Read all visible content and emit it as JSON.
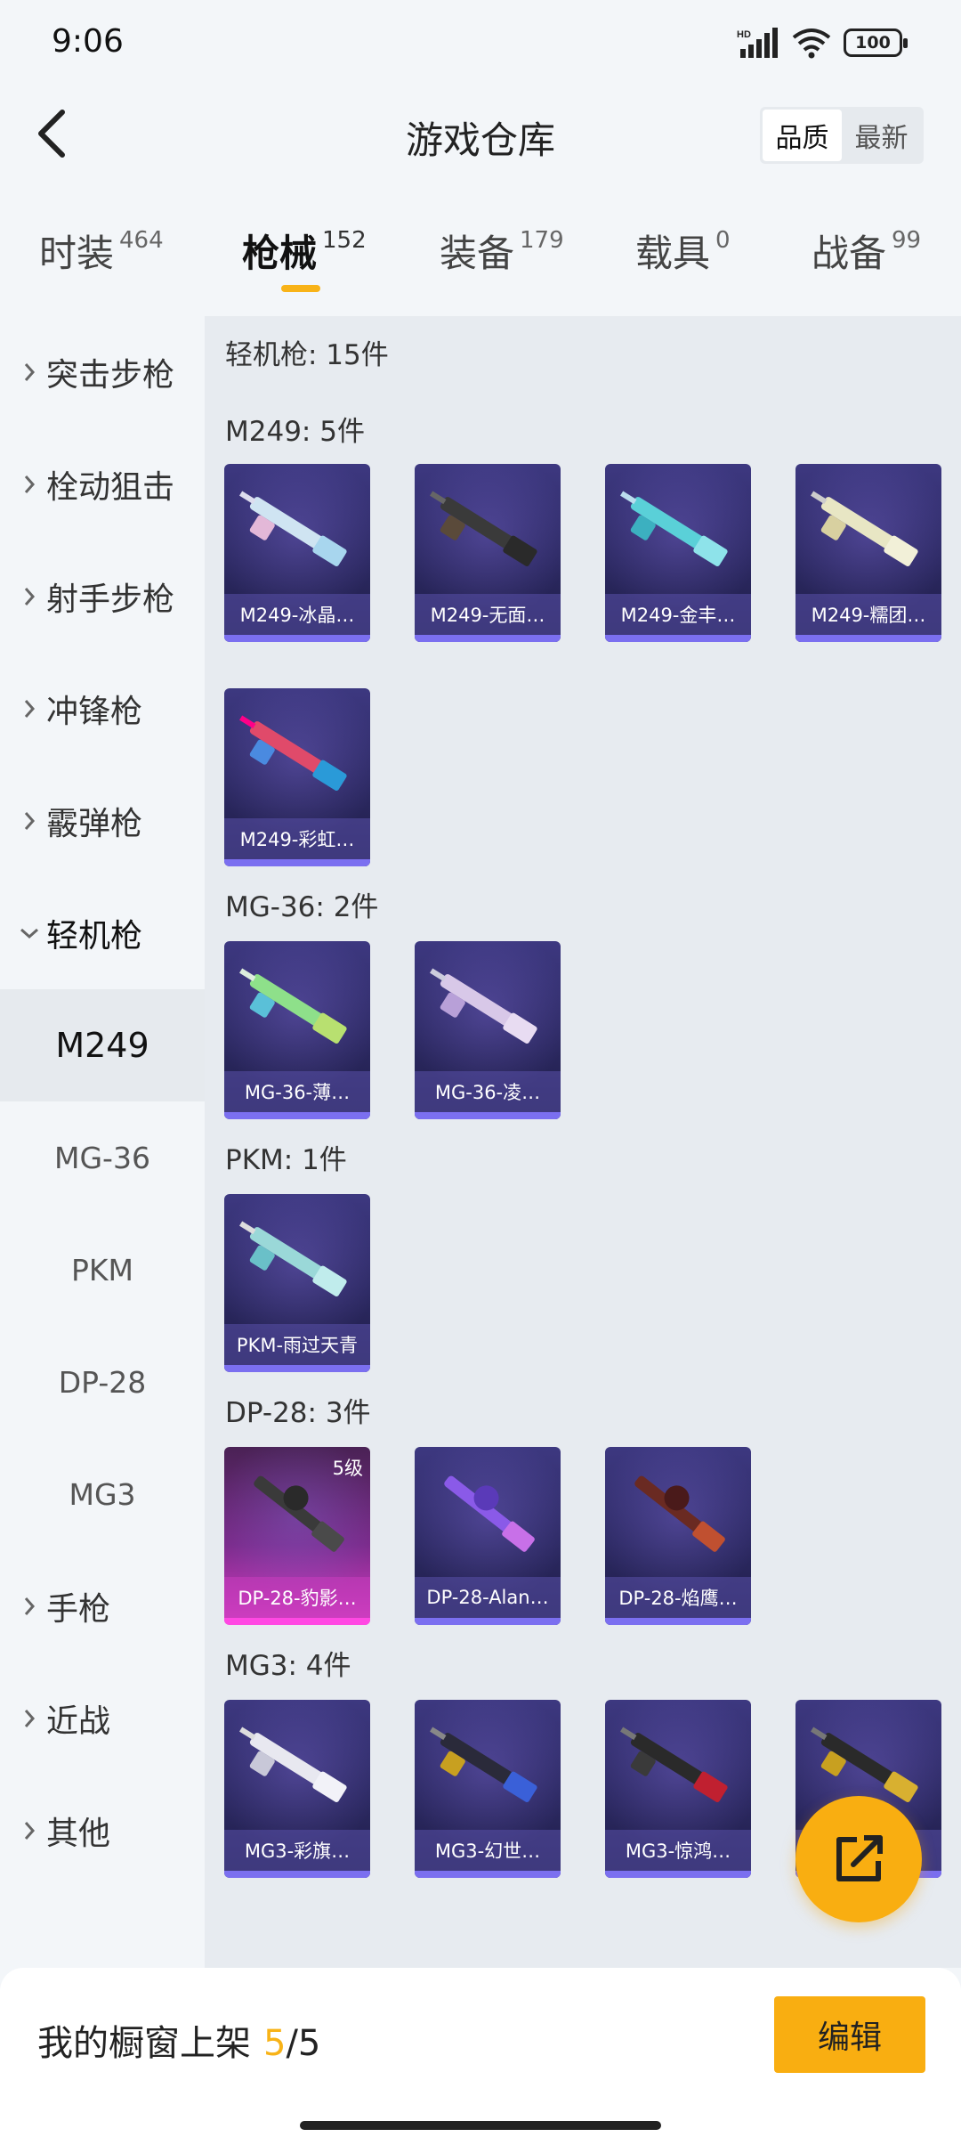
{
  "status_bar": {
    "time": "9:06",
    "battery": "100",
    "signal_label": "HD"
  },
  "header": {
    "title": "游戏仓库",
    "sort_options": [
      "品质",
      "最新"
    ],
    "sort_active": "品质"
  },
  "tabs": [
    {
      "label": "时装",
      "count": "464"
    },
    {
      "label": "枪械",
      "count": "152",
      "active": true
    },
    {
      "label": "装备",
      "count": "179"
    },
    {
      "label": "载具",
      "count": "0"
    },
    {
      "label": "战备",
      "count": "99"
    }
  ],
  "sidebar": {
    "categories": [
      {
        "label": "突击步枪"
      },
      {
        "label": "栓动狙击"
      },
      {
        "label": "射手步枪"
      },
      {
        "label": "冲锋枪"
      },
      {
        "label": "霰弹枪"
      },
      {
        "label": "轻机枪",
        "expanded": true
      },
      {
        "label": "手枪"
      },
      {
        "label": "近战"
      },
      {
        "label": "其他"
      }
    ],
    "sub_items": [
      "M249",
      "MG-36",
      "PKM",
      "DP-28",
      "MG3"
    ],
    "selected_sub": "M249"
  },
  "content": {
    "category_summary": "轻机枪: 15件",
    "groups": [
      {
        "title": "M249: 5件",
        "items": [
          "M249-冰晶…",
          "M249-无面…",
          "M249-金丰…",
          "M249-糯团…",
          "M249-彩虹…"
        ]
      },
      {
        "title": "MG-36: 2件",
        "items": [
          "MG-36-薄…",
          "MG-36-凌…"
        ]
      },
      {
        "title": "PKM: 1件",
        "items": [
          "PKM-雨过天青"
        ]
      },
      {
        "title": "DP-28: 3件",
        "items": [
          "DP-28-豹影…",
          "DP-28-Alan…",
          "DP-28-焰鹰…"
        ],
        "first_badge": "5级"
      },
      {
        "title": "MG3: 4件",
        "items": [
          "MG3-彩旗…",
          "MG3-幻世…",
          "MG3-惊鸿…",
          ""
        ]
      }
    ]
  },
  "bottom_bar": {
    "label": "我的橱窗上架",
    "count": "5",
    "total": "/5",
    "edit_label": "编辑"
  },
  "colors": {
    "accent": "#f9ae11",
    "card_dark": "#2c2962",
    "card_magenta": "#d93fc7"
  }
}
